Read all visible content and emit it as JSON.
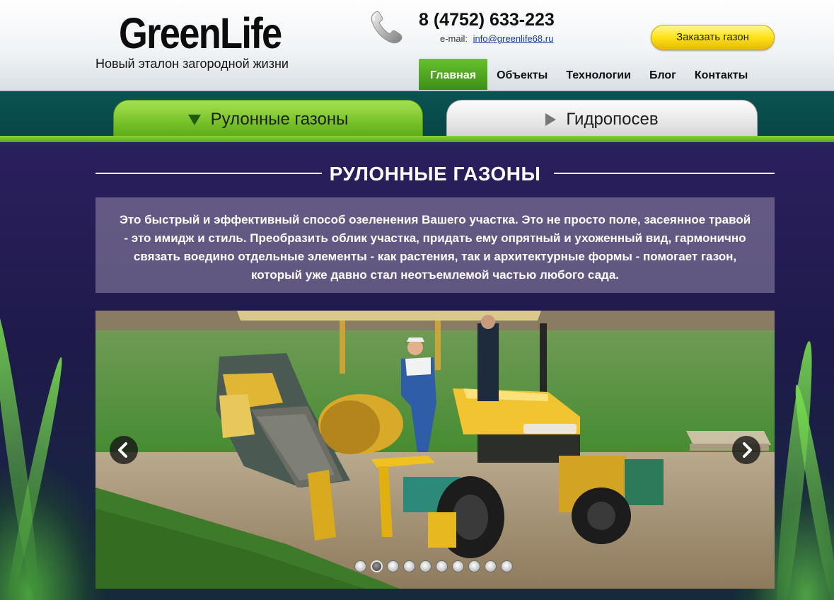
{
  "header": {
    "logo": "GreenLife",
    "tagline": "Новый эталон загородной жизни",
    "phone": "8 (4752) 633-223",
    "email_label": "e-mail:",
    "email": "info@greenlife68.ru",
    "order_button": "Заказать газон",
    "phone_icon": "phone-handset-icon"
  },
  "nav": {
    "items": [
      {
        "label": "Главная",
        "active": true
      },
      {
        "label": "Объекты",
        "active": false
      },
      {
        "label": "Технологии",
        "active": false
      },
      {
        "label": "Блог",
        "active": false
      },
      {
        "label": "Контакты",
        "active": false
      }
    ]
  },
  "tabs": [
    {
      "label": "Рулонные газоны",
      "active": true,
      "icon": "triangle-down-icon"
    },
    {
      "label": "Гидропосев",
      "active": false,
      "icon": "triangle-right-icon"
    }
  ],
  "section": {
    "title": "РУЛОННЫЕ ГАЗОНЫ",
    "intro": "Это быстрый и эффективный способ озеленения Вашего участка. Это не просто поле, засеянное травой - это имидж и стиль. Преобразить облик участка, придать ему опрятный и ухоженный вид, гармонично связать воедино отдельные элементы - как растения, так и архитектурные формы - помогает газон, который уже давно стал неотъемлемой частью любого сада."
  },
  "slider": {
    "prev_icon": "chevron-left-icon",
    "next_icon": "chevron-right-icon",
    "slide_count": 10,
    "active_slide": 2
  },
  "colors": {
    "nav_active": "#4fa81e",
    "tab_active": "#79c32a",
    "band": "#0a5352",
    "order_button": "#ffe51e",
    "background": "#1e1a4a"
  }
}
